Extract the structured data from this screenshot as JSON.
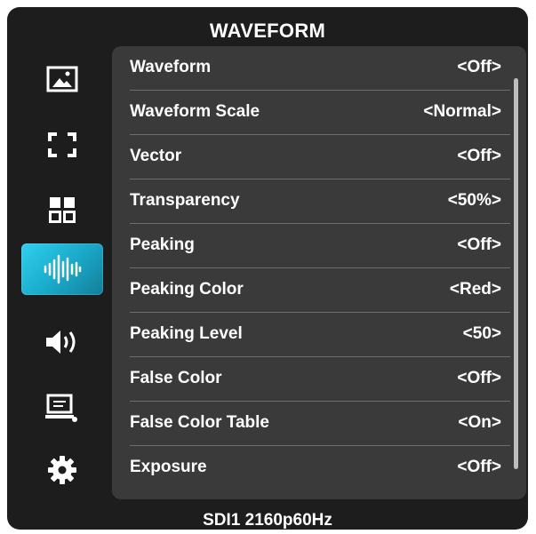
{
  "header": {
    "title": "WAVEFORM"
  },
  "sidebar": {
    "items": [
      {
        "icon": "image-icon",
        "active": false
      },
      {
        "icon": "frame-corners-icon",
        "active": false
      },
      {
        "icon": "grid-icon",
        "active": false
      },
      {
        "icon": "waveform-icon",
        "active": true
      },
      {
        "icon": "speaker-icon",
        "active": false
      },
      {
        "icon": "monitor-icon",
        "active": false
      },
      {
        "icon": "gear-icon",
        "active": false
      }
    ]
  },
  "menu": {
    "rows": [
      {
        "label": "Waveform",
        "value": "<Off>"
      },
      {
        "label": "Waveform Scale",
        "value": "<Normal>"
      },
      {
        "label": "Vector",
        "value": "<Off>"
      },
      {
        "label": "Transparency",
        "value": "<50%>"
      },
      {
        "label": "Peaking",
        "value": "<Off>"
      },
      {
        "label": "Peaking Color",
        "value": "<Red>"
      },
      {
        "label": "Peaking Level",
        "value": "<50>"
      },
      {
        "label": "False Color",
        "value": "<Off>"
      },
      {
        "label": "False Color Table",
        "value": "<On>"
      },
      {
        "label": "Exposure",
        "value": "<Off>"
      }
    ]
  },
  "footer": {
    "status": "SDI1 2160p60Hz"
  },
  "colors": {
    "accent": "#1fb8d8",
    "background": "#1d1d1d",
    "panel": "#3a3a3a",
    "text": "#ffffff"
  }
}
